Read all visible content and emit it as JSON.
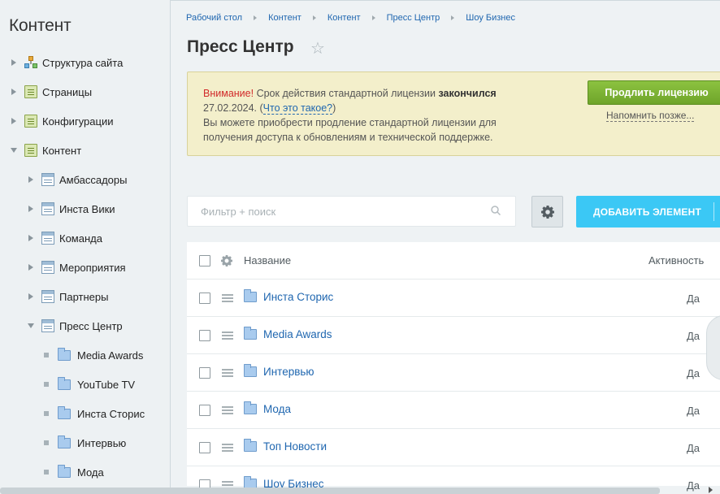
{
  "sidebar": {
    "title": "Контент",
    "items": [
      {
        "label": "Структура сайта",
        "icon": "structure-icon",
        "arrow": "right",
        "level": 0
      },
      {
        "label": "Страницы",
        "icon": "page-icon",
        "arrow": "right",
        "level": 0
      },
      {
        "label": "Конфигурации",
        "icon": "page-icon",
        "arrow": "right",
        "level": 0
      },
      {
        "label": "Контент",
        "icon": "page-icon",
        "arrow": "down",
        "level": 0
      },
      {
        "label": "Амбассадоры",
        "icon": "list-icon",
        "arrow": "right",
        "level": 1
      },
      {
        "label": "Инста Вики",
        "icon": "list-icon",
        "arrow": "right",
        "level": 1
      },
      {
        "label": "Команда",
        "icon": "list-icon",
        "arrow": "right",
        "level": 1
      },
      {
        "label": "Мероприятия",
        "icon": "list-icon",
        "arrow": "right",
        "level": 1
      },
      {
        "label": "Партнеры",
        "icon": "list-icon",
        "arrow": "right",
        "level": 1
      },
      {
        "label": "Пресс Центр",
        "icon": "list-icon",
        "arrow": "down",
        "level": 1
      },
      {
        "label": "Media Awards",
        "icon": "folder-icon",
        "arrow": "bullet",
        "level": 2
      },
      {
        "label": "YouTube TV",
        "icon": "folder-icon",
        "arrow": "bullet",
        "level": 2
      },
      {
        "label": "Инста Сторис",
        "icon": "folder-icon",
        "arrow": "bullet",
        "level": 2
      },
      {
        "label": "Интервью",
        "icon": "folder-icon",
        "arrow": "bullet",
        "level": 2
      },
      {
        "label": "Мода",
        "icon": "folder-icon",
        "arrow": "bullet",
        "level": 2
      }
    ]
  },
  "breadcrumb": [
    "Рабочий стол",
    "Контент",
    "Контент",
    "Пресс Центр",
    "Шоу Бизнес"
  ],
  "page": {
    "title": "Пресс Центр"
  },
  "notice": {
    "warning": "Внимание!",
    "text1": " Срок действия стандартной лицензии ",
    "bold": "закончился",
    "date": "27.02.2024. (",
    "link": "Что это такое?",
    "close_paren": ")",
    "text2": "Вы можете приобрести продление стандартной лицензии для получения доступа к обновлениям и технической поддержке.",
    "renew_button": "Продлить лицензию",
    "remind_link": "Напомнить позже..."
  },
  "toolbar": {
    "search_placeholder": "Фильтр + поиск",
    "add_button": "ДОБАВИТЬ ЭЛЕМЕНТ"
  },
  "grid": {
    "columns": {
      "name": "Название",
      "active": "Активность"
    },
    "rows": [
      {
        "name": "Инста Сторис",
        "active": "Да"
      },
      {
        "name": "Media Awards",
        "active": "Да"
      },
      {
        "name": "Интервью",
        "active": "Да"
      },
      {
        "name": "Мода",
        "active": "Да"
      },
      {
        "name": "Топ Новости",
        "active": "Да"
      },
      {
        "name": "Шоу Бизнес",
        "active": "Да"
      }
    ]
  },
  "colors": {
    "add_button": "#3bc8f5",
    "renew_button": "#7bb130",
    "link": "#2067b0",
    "warning": "#d12a2a"
  }
}
